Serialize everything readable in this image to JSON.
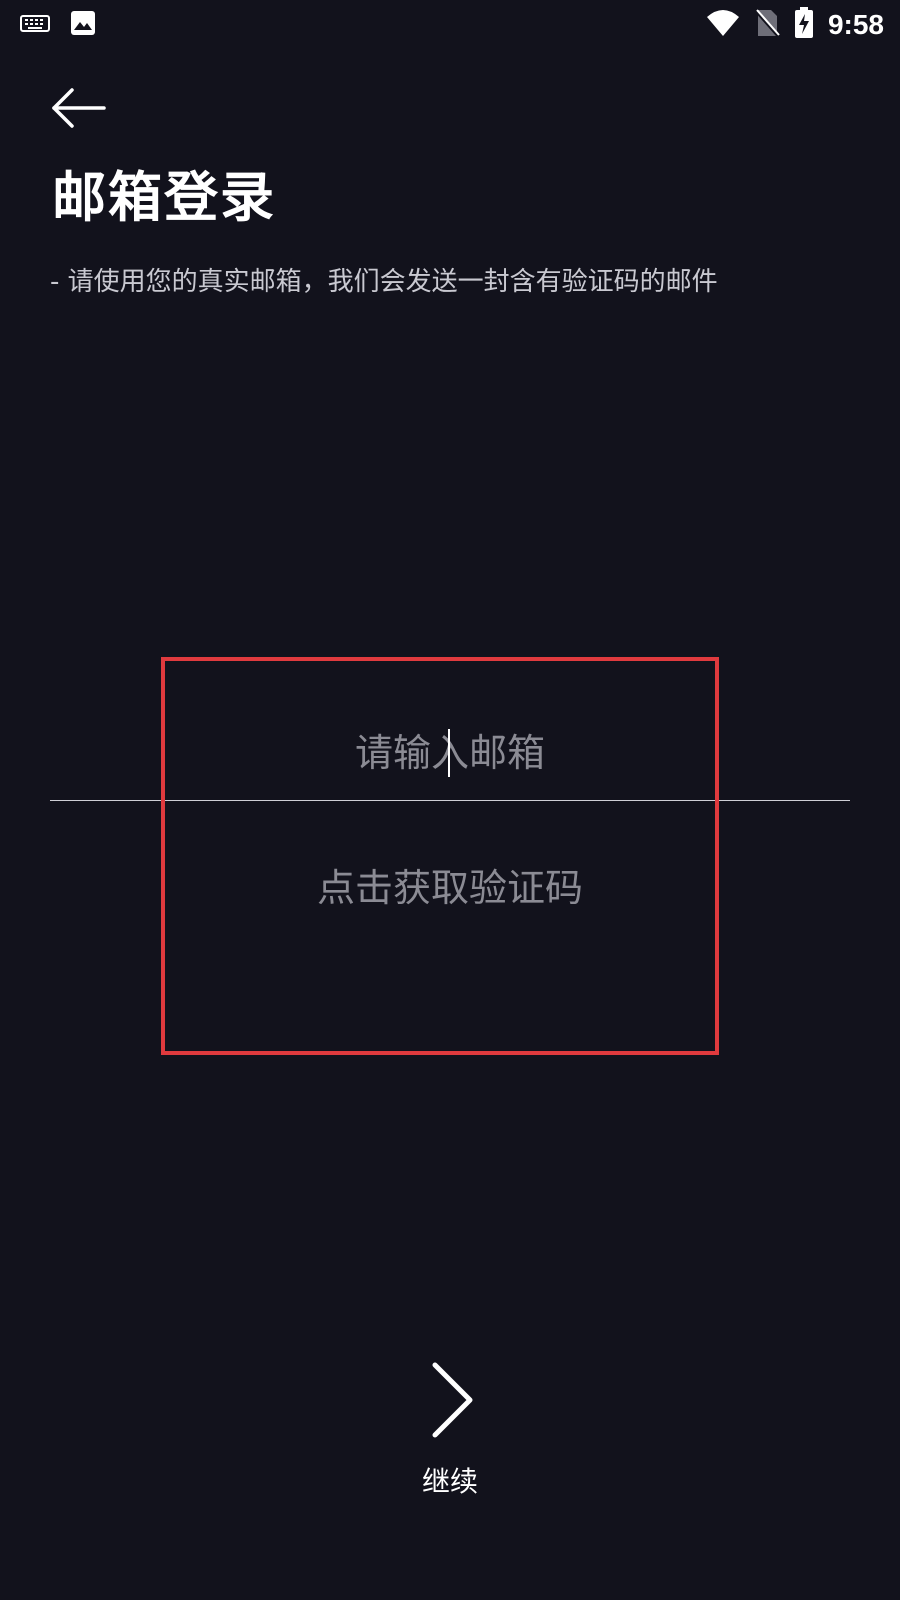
{
  "status_bar": {
    "left_icons": [
      "keyboard-icon",
      "image-icon"
    ],
    "right_icons": [
      "wifi-icon",
      "no-sim-icon",
      "battery-charging-icon"
    ],
    "time": "9:58"
  },
  "header": {
    "back_icon": "arrow-left-icon",
    "title": "邮箱登录",
    "subtitle": "- 请使用您的真实邮箱，我们会发送一封含有验证码的邮件"
  },
  "form": {
    "email_placeholder": "请输入邮箱",
    "email_value": "",
    "get_code_label": "点击获取验证码"
  },
  "footer": {
    "continue_icon": "chevron-right-icon",
    "continue_label": "继续"
  },
  "colors": {
    "background": "#12121c",
    "text_primary": "#ffffff",
    "text_placeholder": "#8b8b94",
    "highlight": "#e03a3e"
  }
}
